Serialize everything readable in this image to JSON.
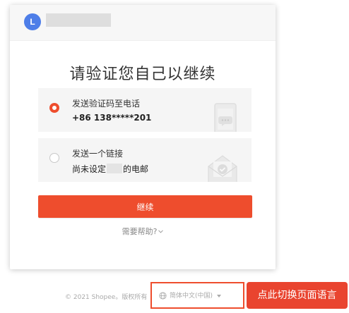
{
  "header": {
    "avatar_letter": "L"
  },
  "title": "请验证您自己以继续",
  "options": [
    {
      "label": "发送验证码至电话",
      "value": "+86 138*****201",
      "selected": true,
      "icon": "phone-chat-icon"
    },
    {
      "label": "发送一个链接",
      "value_prefix": "尚未设定",
      "value_suffix": "的电邮",
      "selected": false,
      "icon": "envelope-check-icon"
    }
  ],
  "continue_label": "继续",
  "help_label": "需要帮助?",
  "footer": {
    "copyright": "© 2021 Shopee。版权所有",
    "language": "简体中文(中国)"
  },
  "tooltip": "点此切换页面语言",
  "colors": {
    "accent": "#ee4d2d",
    "avatar": "#4e7ee8",
    "tooltip": "#e9442f"
  }
}
